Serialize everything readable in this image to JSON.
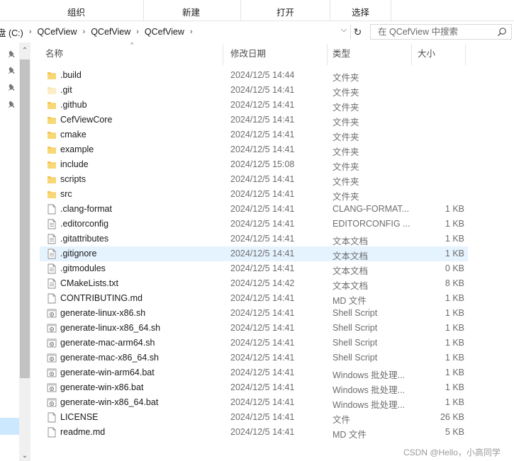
{
  "ribbon": {
    "groups": [
      "组织",
      "新建",
      "打开",
      "选择"
    ]
  },
  "address": {
    "crumbs": [
      "盘 (C:)",
      "QCefView",
      "QCefView",
      "QCefView"
    ]
  },
  "search": {
    "placeholder": "在 QCefView 中搜索"
  },
  "columns": {
    "name": "名称",
    "date": "修改日期",
    "type": "类型",
    "size": "大小"
  },
  "files": [
    {
      "name": ".build",
      "date": "2024/12/5 14:44",
      "type": "文件夹",
      "size": "",
      "icon": "folder-icon"
    },
    {
      "name": ".git",
      "date": "2024/12/5 14:41",
      "type": "文件夹",
      "size": "",
      "icon": "folder-hidden-icon"
    },
    {
      "name": ".github",
      "date": "2024/12/5 14:41",
      "type": "文件夹",
      "size": "",
      "icon": "folder-icon"
    },
    {
      "name": "CefViewCore",
      "date": "2024/12/5 14:41",
      "type": "文件夹",
      "size": "",
      "icon": "folder-icon"
    },
    {
      "name": "cmake",
      "date": "2024/12/5 14:41",
      "type": "文件夹",
      "size": "",
      "icon": "folder-icon"
    },
    {
      "name": "example",
      "date": "2024/12/5 14:41",
      "type": "文件夹",
      "size": "",
      "icon": "folder-icon"
    },
    {
      "name": "include",
      "date": "2024/12/5 15:08",
      "type": "文件夹",
      "size": "",
      "icon": "folder-icon"
    },
    {
      "name": "scripts",
      "date": "2024/12/5 14:41",
      "type": "文件夹",
      "size": "",
      "icon": "folder-icon"
    },
    {
      "name": "src",
      "date": "2024/12/5 14:41",
      "type": "文件夹",
      "size": "",
      "icon": "folder-icon"
    },
    {
      "name": ".clang-format",
      "date": "2024/12/5 14:41",
      "type": "CLANG-FORMAT...",
      "size": "1 KB",
      "icon": "file-icon"
    },
    {
      "name": ".editorconfig",
      "date": "2024/12/5 14:41",
      "type": "EDITORCONFIG ...",
      "size": "1 KB",
      "icon": "text-file-icon"
    },
    {
      "name": ".gitattributes",
      "date": "2024/12/5 14:41",
      "type": "文本文档",
      "size": "1 KB",
      "icon": "text-file-icon"
    },
    {
      "name": ".gitignore",
      "date": "2024/12/5 14:41",
      "type": "文本文档",
      "size": "1 KB",
      "icon": "text-file-icon"
    },
    {
      "name": ".gitmodules",
      "date": "2024/12/5 14:41",
      "type": "文本文档",
      "size": "0 KB",
      "icon": "text-file-icon"
    },
    {
      "name": "CMakeLists.txt",
      "date": "2024/12/5 14:42",
      "type": "文本文档",
      "size": "8 KB",
      "icon": "text-file-icon"
    },
    {
      "name": "CONTRIBUTING.md",
      "date": "2024/12/5 14:41",
      "type": "MD 文件",
      "size": "1 KB",
      "icon": "file-icon"
    },
    {
      "name": "generate-linux-x86.sh",
      "date": "2024/12/5 14:41",
      "type": "Shell Script",
      "size": "1 KB",
      "icon": "script-file-icon"
    },
    {
      "name": "generate-linux-x86_64.sh",
      "date": "2024/12/5 14:41",
      "type": "Shell Script",
      "size": "1 KB",
      "icon": "script-file-icon"
    },
    {
      "name": "generate-mac-arm64.sh",
      "date": "2024/12/5 14:41",
      "type": "Shell Script",
      "size": "1 KB",
      "icon": "script-file-icon"
    },
    {
      "name": "generate-mac-x86_64.sh",
      "date": "2024/12/5 14:41",
      "type": "Shell Script",
      "size": "1 KB",
      "icon": "script-file-icon"
    },
    {
      "name": "generate-win-arm64.bat",
      "date": "2024/12/5 14:41",
      "type": "Windows 批处理...",
      "size": "1 KB",
      "icon": "script-file-icon"
    },
    {
      "name": "generate-win-x86.bat",
      "date": "2024/12/5 14:41",
      "type": "Windows 批处理...",
      "size": "1 KB",
      "icon": "script-file-icon"
    },
    {
      "name": "generate-win-x86_64.bat",
      "date": "2024/12/5 14:41",
      "type": "Windows 批处理...",
      "size": "1 KB",
      "icon": "script-file-icon"
    },
    {
      "name": "LICENSE",
      "date": "2024/12/5 14:41",
      "type": "文件",
      "size": "26 KB",
      "icon": "file-icon"
    },
    {
      "name": "readme.md",
      "date": "2024/12/5 14:41",
      "type": "MD 文件",
      "size": "5 KB",
      "icon": "file-icon"
    }
  ],
  "highlighted_row": ".gitignore",
  "watermark": "CSDN @Hello，小高同学",
  "colors": {
    "folder": "#f3c44e",
    "hover": "#e5f3ff",
    "selection": "#cce8ff"
  }
}
